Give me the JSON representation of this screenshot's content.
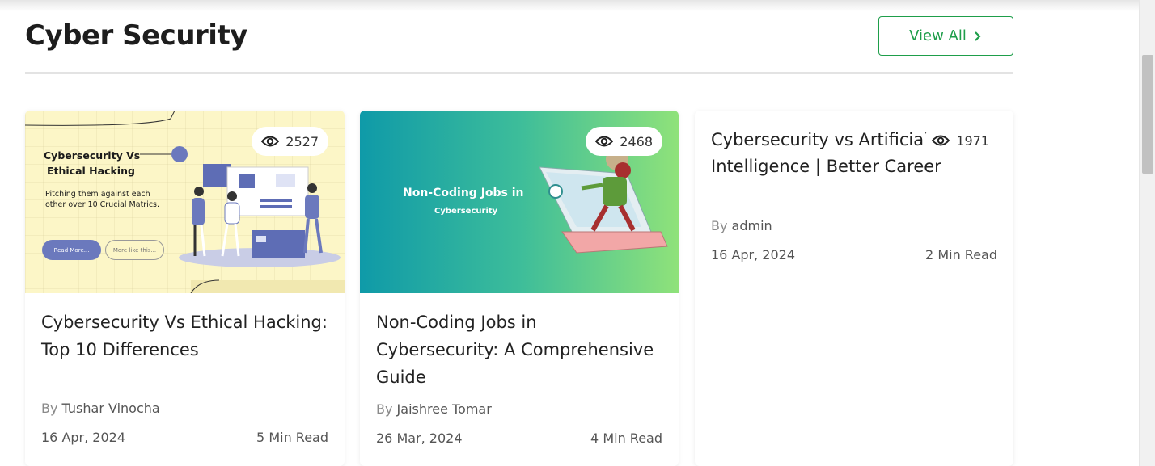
{
  "section": {
    "title": "Cyber Security",
    "view_all_label": "View All"
  },
  "cards": [
    {
      "title": "Cybersecurity Vs Ethical Hacking: Top 10 Differences",
      "views": "2527",
      "by_label": "By",
      "author": "Tushar Vinocha",
      "date": "16 Apr, 2024",
      "read_time": "5 Min Read",
      "image": {
        "heading_line1": "Cybersecurity Vs",
        "heading_line2": "Ethical Hacking",
        "subtext": "Pitching them against each other over 10 Crucial Matrics.",
        "button1": "Read More...",
        "button2": "More like this..."
      }
    },
    {
      "title": "Non-Coding Jobs in Cybersecurity: A Comprehensive Guide",
      "views": "2468",
      "by_label": "By",
      "author": "Jaishree Tomar",
      "date": "26 Mar, 2024",
      "read_time": "4 Min Read",
      "image": {
        "heading": "Non-Coding Jobs in",
        "subheading": "Cybersecurity"
      }
    },
    {
      "title": "Cybersecurity vs Artificial Intelligence | Better Career",
      "views": "1971",
      "by_label": "By",
      "author": "admin",
      "date": "16 Apr, 2024",
      "read_time": "2 Min Read"
    }
  ],
  "colors": {
    "accent": "#1e9e4a",
    "divider": "#e3e3e3"
  }
}
